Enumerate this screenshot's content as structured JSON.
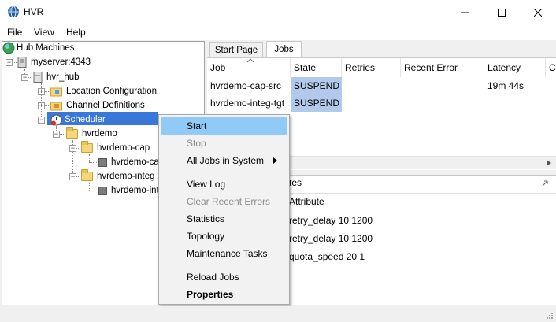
{
  "window": {
    "title": "HVR",
    "icon": "hvr-globe-icon",
    "controls": [
      "minimize",
      "maximize",
      "close"
    ]
  },
  "menu": [
    "File",
    "View",
    "Help"
  ],
  "tree": {
    "root": "Hub Machines",
    "server": "myserver:4343",
    "hub": "hvr_hub",
    "location_configuration": "Location Configuration",
    "channel_definitions": "Channel Definitions",
    "scheduler": "Scheduler",
    "hvrdemo": "hvrdemo",
    "hvrdemo_cap": "hvrdemo-cap",
    "hvrdemo_cap_child": "hvrdemo-cap",
    "hvrdemo_integ": "hvrdemo-integ",
    "hvrdemo_integ_child": "hvrdemo-inte"
  },
  "tabs": [
    {
      "label": "Start Page",
      "active": false
    },
    {
      "label": "Jobs",
      "active": true
    }
  ],
  "jobs_table": {
    "columns": [
      "Job",
      "State",
      "Retries",
      "Recent Error",
      "Latency",
      "C"
    ],
    "rows": [
      {
        "job": "hvrdemo-cap-src",
        "state": "SUSPEND",
        "retries": "",
        "recent_error": "",
        "latency": "19m 44s"
      },
      {
        "job": "hvrdemo-integ-tgt",
        "state": "SUSPEND",
        "retries": "",
        "recent_error": "",
        "latency": ""
      }
    ]
  },
  "lower_panel": {
    "tab_partial": "tes",
    "column": "Attribute",
    "rows": [
      "retry_delay 10 1200",
      "retry_delay 10 1200",
      "quota_speed 20 1"
    ]
  },
  "context_menu": {
    "items": [
      {
        "label": "Start",
        "state": "highlighted"
      },
      {
        "label": "Stop",
        "state": "disabled"
      },
      {
        "label": "All Jobs in System",
        "state": "submenu"
      },
      {
        "label": "View Log",
        "state": "normal"
      },
      {
        "label": "Clear Recent Errors",
        "state": "disabled"
      },
      {
        "label": "Statistics",
        "state": "normal"
      },
      {
        "label": "Topology",
        "state": "normal"
      },
      {
        "label": "Maintenance Tasks",
        "state": "normal"
      },
      {
        "label": "Reload Jobs",
        "state": "normal"
      },
      {
        "label": "Properties",
        "state": "bold"
      }
    ]
  },
  "colors": {
    "selection": "#3978d8",
    "menu_highlight": "#91c9f7",
    "suspend_cell": "#b1c9ea"
  }
}
